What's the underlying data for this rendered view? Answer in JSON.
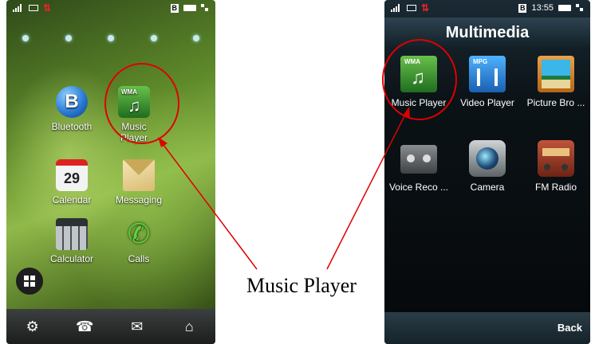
{
  "caption": "Music Player",
  "left_screen": {
    "apps": [
      {
        "label": "Bluetooth",
        "icon": "bluetooth-icon",
        "badge": "B"
      },
      {
        "label": "Music Player",
        "icon": "music-player-icon",
        "badge": "WMA"
      },
      {
        "label": "Calendar",
        "icon": "calendar-icon",
        "badge": "29"
      },
      {
        "label": "Messaging",
        "icon": "envelope-icon"
      },
      {
        "label": "Calculator",
        "icon": "calculator-icon"
      },
      {
        "label": "Calls",
        "icon": "phone-icon"
      }
    ],
    "dock": [
      "settings-icon",
      "contacts-icon",
      "mail-icon",
      "home-icon"
    ]
  },
  "right_screen": {
    "status": {
      "time": "13:55",
      "badge": "B"
    },
    "title": "Multimedia",
    "apps": [
      {
        "label": "Music Player",
        "icon": "music-player-icon",
        "badge": "WMA"
      },
      {
        "label": "Video Player",
        "icon": "video-player-icon",
        "badge": "MPG"
      },
      {
        "label": "Picture Bro ...",
        "icon": "picture-browser-icon"
      },
      {
        "label": "Voice Reco ...",
        "icon": "voice-recorder-icon"
      },
      {
        "label": "Camera",
        "icon": "camera-icon"
      },
      {
        "label": "FM Radio",
        "icon": "radio-icon"
      }
    ],
    "back_label": "Back"
  },
  "colors": {
    "annotation": "#e00000",
    "music_icon": "#2f8a2b",
    "bluetooth": "#2a7bd6"
  }
}
